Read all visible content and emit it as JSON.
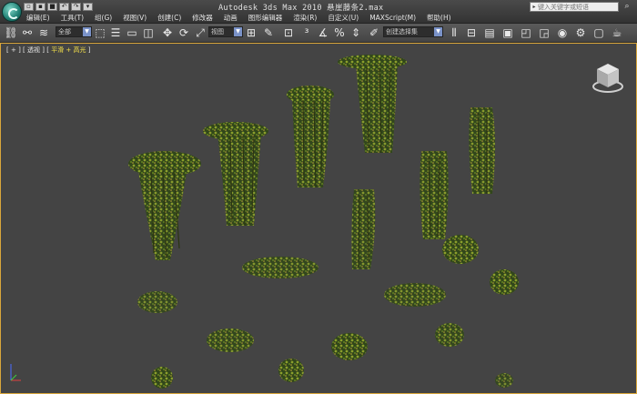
{
  "titlebar": {
    "title": "Autodesk 3ds Max  2010   悬崖藤条2.max",
    "search_placeholder": "键入关键字或短语",
    "quick_access": [
      "new",
      "open",
      "save",
      "undo",
      "redo",
      "more"
    ]
  },
  "menu": {
    "items": [
      "编辑(E)",
      "工具(T)",
      "组(G)",
      "视图(V)",
      "创建(C)",
      "修改器",
      "动画",
      "图形编辑器",
      "渲染(R)",
      "自定义(U)",
      "MAXScript(M)",
      "帮助(H)"
    ]
  },
  "toolbar": {
    "selection_filter": "全部",
    "reference_coordinate": "视图",
    "named_selection": "创建选择集",
    "icons": [
      "link-icon",
      "unlink-icon",
      "bind-spacewarp-icon",
      "select-filter",
      "select-object-icon",
      "select-by-name-icon",
      "rect-selection-icon",
      "window-crossing-icon",
      "move-icon",
      "rotate-icon",
      "scale-icon",
      "reference-coord",
      "pivot-center-icon",
      "select-manipulate-icon",
      "keyboard-shortcut-icon",
      "snap-3-icon",
      "angle-snap-icon",
      "percent-snap-icon",
      "spinner-snap-icon",
      "edit-named-selection-icon",
      "named-selection",
      "mirror-icon",
      "align-icon",
      "layer-manager-icon",
      "graphite-icon",
      "curve-editor-icon",
      "schematic-view-icon",
      "material-editor-icon",
      "render-setup-icon",
      "rendered-frame-icon",
      "render-icon"
    ]
  },
  "viewport": {
    "label_bracket_open": "[",
    "label_plus": "+",
    "label_view": "透视",
    "label_shading": "平滑 + 高光",
    "label_bracket_close": "]",
    "border_color": "#d9a63b",
    "background_color": "#444444"
  }
}
